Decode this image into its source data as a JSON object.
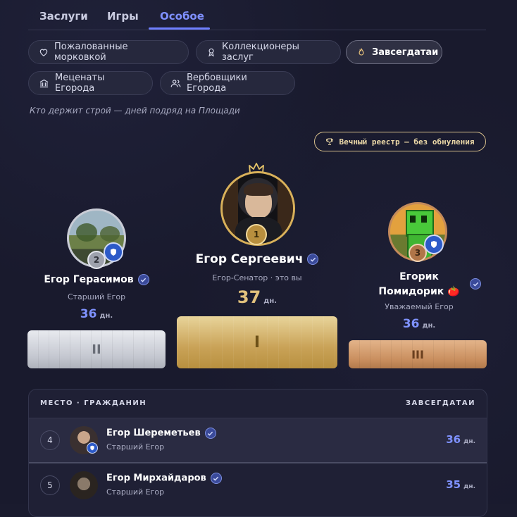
{
  "tabs": [
    {
      "label": "Заслуги"
    },
    {
      "label": "Игры"
    },
    {
      "label": "Особое"
    }
  ],
  "chips": {
    "carrots": "Пожалованные морковкой",
    "collectors": "Коллекционеры заслуг",
    "regulars": "Завсегдатаи",
    "patrons": "Меценаты Егорода",
    "recruiters": "Вербовщики Егорода"
  },
  "subtitle": "Кто держит строй — дней подряд на Площади",
  "registry": "Вечный реестр — без обнуления",
  "podium": {
    "first": {
      "rank": "1",
      "name": "Егор Сергеевич",
      "role": "Егор-Сенатор · это вы",
      "days": "37",
      "unit": "дн.",
      "numeral": "I"
    },
    "second": {
      "rank": "2",
      "name": "Егор Герасимов",
      "role": "Старший Егор",
      "days": "36",
      "unit": "дн.",
      "numeral": "II"
    },
    "third": {
      "rank": "3",
      "name_line1": "Егорик",
      "name_line2": "Помидорик 🍅",
      "role": "Уважаемый Егор",
      "days": "36",
      "unit": "дн.",
      "numeral": "III"
    }
  },
  "table": {
    "col_left": "МЕСТО · ГРАЖДАНИН",
    "col_right": "ЗАВСЕГДАТАИ",
    "rows": [
      {
        "rank": "4",
        "name": "Егор Шереметьев",
        "role": "Старший Егор",
        "days": "36",
        "unit": "дн."
      },
      {
        "rank": "5",
        "name": "Егор Мирхайдаров",
        "role": "Старший Егор",
        "days": "35",
        "unit": "дн."
      }
    ]
  },
  "colors": {
    "accent": "#7f90ff",
    "gold": "#d4a94a",
    "silver": "#c9ccd6",
    "bronze": "#c48a5a"
  }
}
